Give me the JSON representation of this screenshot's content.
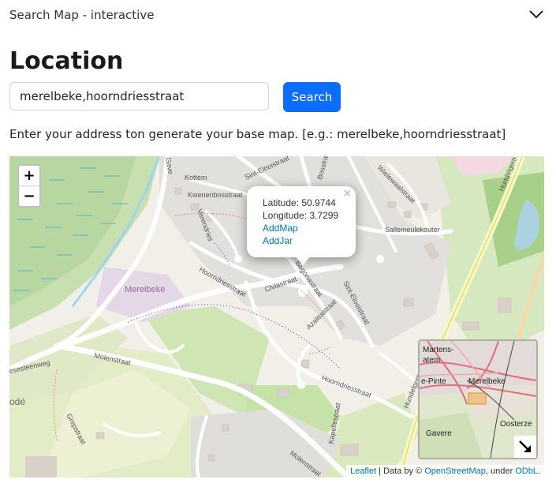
{
  "header": {
    "title": "Search Map - interactive",
    "toggle_icon": "chevron-down-icon"
  },
  "page": {
    "heading": "Location"
  },
  "search": {
    "value": "merelbeke,hoorndriesstraat",
    "button_label": "Search",
    "hint": "Enter your address ton generate your base map. [e.g.: merelbeke,hoorndriesstraat]"
  },
  "map": {
    "zoom_in": "+",
    "zoom_out": "−",
    "popup": {
      "close": "×",
      "latitude": "Latitude: 50.9744",
      "longitude": "Longitude: 3.7299",
      "links": [
        "AddMap",
        "AddJar"
      ]
    },
    "labels": {
      "merelbeke": "Merelbeke",
      "kottem": "Kottem",
      "kwenenbosstraat": "Kwenenbosstraat",
      "varendries": "Varendries",
      "sint_elooistraat": "Sint-Elooistraat",
      "sint_elooistraat_2": "Sint-Elooistraat",
      "bosstraat": "Bosstraat",
      "wielewaalstraat": "Wielewaalstraat",
      "sallemeulekouter": "Sallemeulekouter",
      "hundelgemsesteenweg": "Hundelgemsesteenweg",
      "hundelgem": "Hundelgem",
      "hoorndriesstraat": "Hoorndriesstraat",
      "hoorndriesstraat_2": "Hoorndriesstraat",
      "civiastraat": "Clviastraat",
      "begonastraat": "Begonastraat",
      "azaleastraat": "Azaleastraat",
      "molenstraat": "Molenstraat",
      "molenstraat_2": "Molenstraat",
      "steenweg": "esesteenweg",
      "grepstraat": "Grepstraat",
      "ode": "odé",
      "gaverstraat": "Gave",
      "kapellestraat": "Kapellestraat"
    },
    "minimap": {
      "labels": [
        "Martens-",
        "atem",
        "e-Pinte",
        "Merelbeke",
        "Oosterze",
        "Gavere"
      ],
      "toggle_icon": "collapse-arrow-icon"
    },
    "attribution": {
      "leaflet": "Leaflet",
      "sep1": " | Data by © ",
      "osm": "OpenStreetMap",
      "sep2": ", under ",
      "odbl": "ODbL",
      "end": "."
    }
  }
}
